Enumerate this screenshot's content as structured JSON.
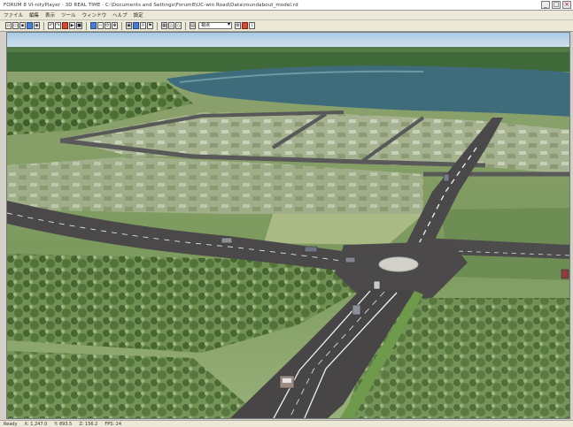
{
  "window": {
    "title": "FORUM 8   VI-nityPlayer   ·   3D REAL TIME   ·   C:\\Documents and Settings\\Forum8\\UC-win Road\\Data\\roundabout_model.rd",
    "minimize_label": "_",
    "maximize_label": "□",
    "close_label": "×"
  },
  "menu": {
    "items": [
      "ファイル",
      "編集",
      "表示",
      "ツール",
      "ウィンドウ",
      "ヘルプ",
      "設定"
    ]
  },
  "toolbar": {
    "view_select_value": "視点"
  },
  "statusbar": {
    "items": [
      "Ready",
      "X: 1,247.0",
      "Y: 893.5",
      "Z: 156.2",
      "FPS: 24"
    ]
  },
  "colors": {
    "sky": "#bcd6ec",
    "horizon_forest": "#3f6a33",
    "lake": "#3d6a78",
    "field": "#7d9d62",
    "road": "#4a4848",
    "roundabout": "#d0cfc9"
  }
}
